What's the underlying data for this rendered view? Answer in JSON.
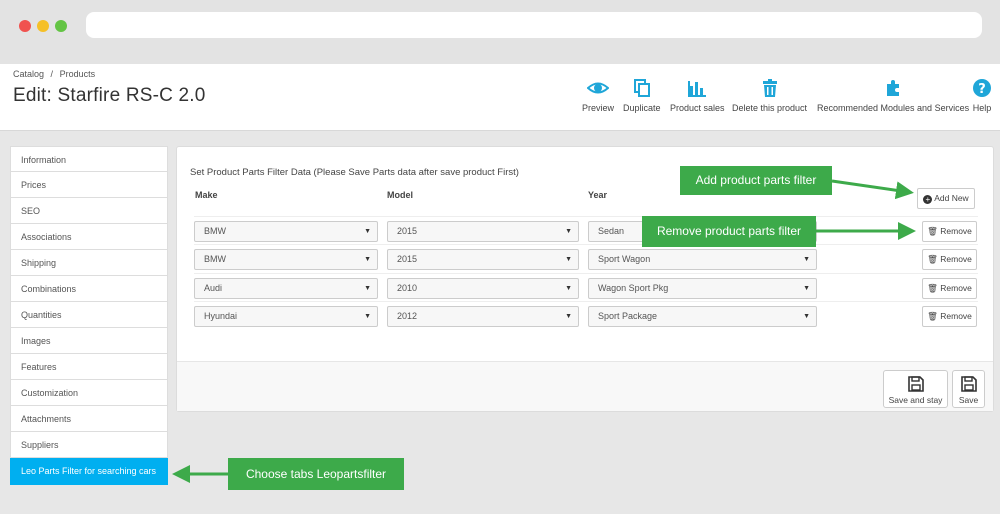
{
  "breadcrumb": {
    "catalog": "Catalog",
    "separator": "/",
    "products": "Products"
  },
  "page_title": "Edit: Starfire RS-C 2.0",
  "toolbar": {
    "preview": "Preview",
    "duplicate": "Duplicate",
    "product_sales": "Product sales",
    "delete": "Delete this product",
    "recommended": "Recommended Modules and Services",
    "help": "Help"
  },
  "sidebar": {
    "items": [
      {
        "label": "Information"
      },
      {
        "label": "Prices"
      },
      {
        "label": "SEO"
      },
      {
        "label": "Associations"
      },
      {
        "label": "Shipping"
      },
      {
        "label": "Combinations"
      },
      {
        "label": "Quantities"
      },
      {
        "label": "Images"
      },
      {
        "label": "Features"
      },
      {
        "label": "Customization"
      },
      {
        "label": "Attachments"
      },
      {
        "label": "Suppliers"
      },
      {
        "label": "Leo Parts Filter for searching cars"
      }
    ],
    "active_index": 12
  },
  "panel": {
    "title": "Set Product Parts Filter Data (Please Save Parts data after save product First)",
    "columns": {
      "make": "Make",
      "model": "Model",
      "year": "Year"
    },
    "add_new_label": "Add New",
    "remove_label": "Remove",
    "rows": [
      {
        "make": "BMW",
        "model": "2015",
        "year": "Sedan"
      },
      {
        "make": "BMW",
        "model": "2015",
        "year": "Sport Wagon"
      },
      {
        "make": "Audi",
        "model": "2010",
        "year": "Wagon Sport Pkg"
      },
      {
        "make": "Hyundai",
        "model": "2012",
        "year": "Sport Package"
      }
    ],
    "save_and_stay_label": "Save and stay",
    "save_label": "Save"
  },
  "annotations": {
    "add": "Add  product parts filter",
    "remove": "Remove  product parts filter",
    "tabs": "Choose tabs Leopartsfilter"
  },
  "colors": {
    "accent": "#00aff0",
    "toolbar_icon": "#1fa6d8",
    "callout": "#3daa4a"
  }
}
